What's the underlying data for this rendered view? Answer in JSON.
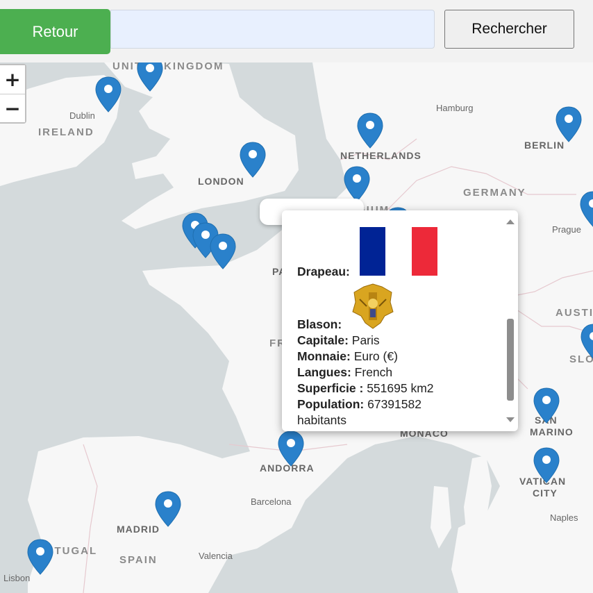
{
  "toolbar": {
    "back_label": "Retour",
    "search_value": "",
    "search_button_label": "Rechercher"
  },
  "zoom": {
    "plus": "+",
    "minus": "−"
  },
  "map": {
    "labels": {
      "united_kingdom": "UNITED KINGDOM",
      "ireland": "IRELAND",
      "dublin": "Dublin",
      "london": "LONDON",
      "netherlands": "NETHERLANDS",
      "hamburg": "Hamburg",
      "berlin": "BERLIN",
      "germany": "GERMANY",
      "belgium_partial": "GIUM",
      "prague": "Prague",
      "paris_partial": "PA",
      "france_partial": "FR",
      "austria_partial": "AUSTI",
      "slovenia_partial": "SLO",
      "monaco": "MONACO",
      "san": "SAN",
      "marino": "MARINO",
      "vatican": "VATICAN",
      "city": "CITY",
      "andorra": "ANDORRA",
      "barcelona": "Barcelona",
      "madrid": "MADRID",
      "spain": "SPAIN",
      "portugal": "PORTUGAL",
      "valencia": "Valencia",
      "lisbon": "Lisbon",
      "naples": "Naples"
    },
    "colors": {
      "land": "#f7f7f7",
      "sea": "#d4dadc",
      "marker": "#2a81cb",
      "border": "#e6c9cf"
    }
  },
  "popup": {
    "flag_label": "Drapeau:",
    "blason_label": "Blason:",
    "capital_label": "Capitale:",
    "capital_value": "Paris",
    "currency_label": "Monnaie:",
    "currency_value": "Euro (€)",
    "languages_label": "Langues:",
    "languages_value": "French",
    "area_label": "Superficie :",
    "area_value": "551695 km2",
    "population_label": "Population:",
    "population_value": "67391582",
    "population_unit": "habitants",
    "flag_colors": [
      "#002395",
      "#ffffff",
      "#ed2939"
    ]
  }
}
